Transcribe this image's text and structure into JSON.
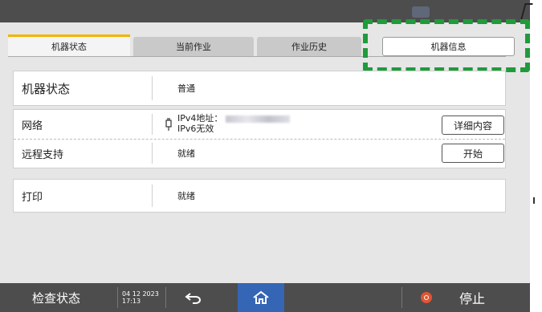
{
  "tabs": [
    {
      "label": "机器状态",
      "active": true
    },
    {
      "label": "当前作业",
      "active": false
    },
    {
      "label": "作业历史",
      "active": false
    },
    {
      "label": "机器信息",
      "active": false
    }
  ],
  "machine_status": {
    "label": "机器状态",
    "value": "普通"
  },
  "network": {
    "label": "网络",
    "ipv4_label": "IPv4地址：",
    "ipv6_label": "IPv6无效",
    "button": "详细内容"
  },
  "remote_support": {
    "label": "远程支持",
    "value": "就绪",
    "button": "开始"
  },
  "print": {
    "label": "打印",
    "value": "就绪"
  },
  "bottom": {
    "check_status": "检查状态",
    "date": "04 12 2023",
    "time": "17:13",
    "stop": "停止"
  },
  "colors": {
    "accent": "#f0b400",
    "highlight": "#1f9b3b",
    "home": "#3565b5",
    "stop": "#e05535"
  },
  "icons": [
    "back-arrow-icon",
    "home-icon",
    "stop-icon",
    "network-plug-icon"
  ]
}
